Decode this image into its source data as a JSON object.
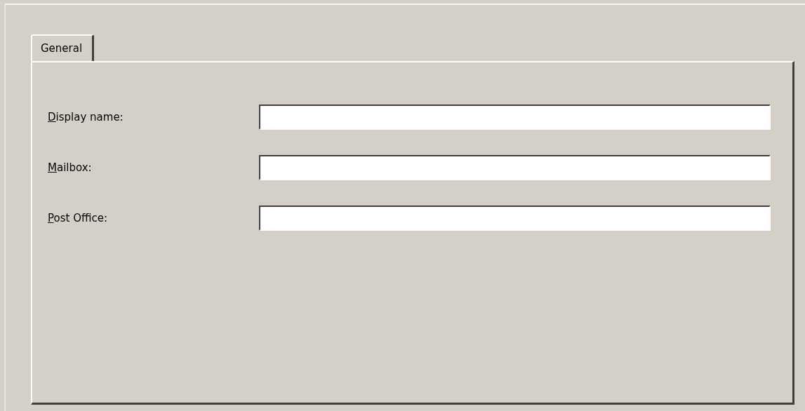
{
  "tabs": [
    {
      "label": "General",
      "selected": true
    }
  ],
  "fields": [
    {
      "label": "Display name:",
      "mnemonic_first": true
    },
    {
      "label": "Mailbox:",
      "mnemonic_first": true
    },
    {
      "label": "Post Office:",
      "mnemonic_first": true
    }
  ]
}
